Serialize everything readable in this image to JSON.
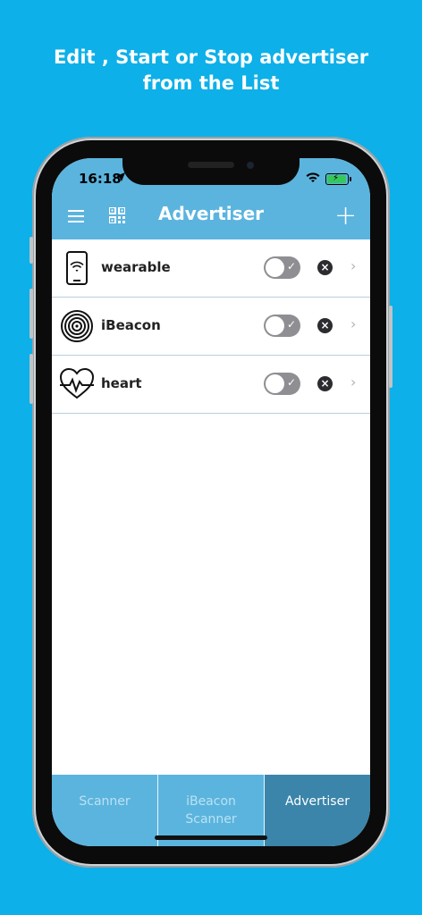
{
  "promo": {
    "line1": "Edit , Start or Stop advertiser",
    "line2": "from the List"
  },
  "status": {
    "time": "16:18"
  },
  "nav": {
    "title": "Advertiser",
    "add_label": "+"
  },
  "list": [
    {
      "label": "wearable",
      "icon": "phone-wifi-icon",
      "enabled": false
    },
    {
      "label": "iBeacon",
      "icon": "ibeacon-icon",
      "enabled": false
    },
    {
      "label": "heart",
      "icon": "heart-pulse-icon",
      "enabled": false
    }
  ],
  "tabs": [
    {
      "label": "Scanner"
    },
    {
      "label": "iBeacon\nScanner"
    },
    {
      "label": "Advertiser"
    }
  ],
  "colors": {
    "background": "#0db0e8",
    "navbar": "#5bb4de",
    "tab_active": "#3b84aa"
  }
}
